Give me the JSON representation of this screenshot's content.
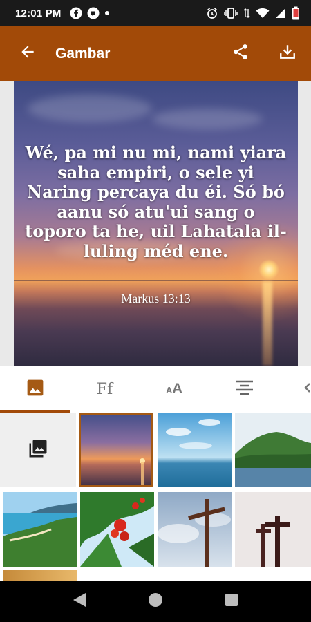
{
  "status_bar": {
    "time": "12:01 PM",
    "left_icons": [
      "facebook-icon",
      "signal-messenger-icon",
      "dot-icon"
    ],
    "right_icons": [
      "alarm-icon",
      "vibrate-icon",
      "data-arrows-icon",
      "wifi-icon",
      "cell-signal-icon",
      "battery-icon"
    ]
  },
  "app_bar": {
    "title": "Gambar",
    "back_icon": "arrow-back-icon",
    "share_icon": "share-icon",
    "download_icon": "download-icon",
    "background_color": "#a24a08"
  },
  "preview": {
    "verse_text": "Wé, pa mi nu mi, nami yiara saha empiri, o sele yi Naring percaya du éi. Só bó aanu só atu'ui sang o toporo ta he, uil Lahatala il-luling méd ene.",
    "reference": "Markus 13:13"
  },
  "tabs": [
    {
      "icon": "image-icon",
      "active": true
    },
    {
      "label": "Ff",
      "icon": "font-family-icon",
      "active": false
    },
    {
      "icon": "text-size-icon",
      "active": false
    },
    {
      "icon": "align-center-icon",
      "active": false
    },
    {
      "icon": "more-tab-icon",
      "active": false
    }
  ],
  "gallery": {
    "pick_icon": "photo-library-icon",
    "images": [
      {
        "name": "sunset-sea",
        "selected": true
      },
      {
        "name": "blue-sea-sky",
        "selected": false
      },
      {
        "name": "green-island",
        "selected": false
      },
      {
        "name": "coastline",
        "selected": false
      },
      {
        "name": "red-flowers-tree",
        "selected": false
      },
      {
        "name": "cross-sky",
        "selected": false
      },
      {
        "name": "crosses-silhouette",
        "selected": false
      }
    ]
  },
  "nav_bar": {
    "icons": [
      "back-triangle-icon",
      "home-circle-icon",
      "recents-square-icon"
    ]
  },
  "colors": {
    "accent": "#a24a08",
    "status_bar": "#1a1a1a",
    "preview_bg": "#e9e9e9"
  }
}
